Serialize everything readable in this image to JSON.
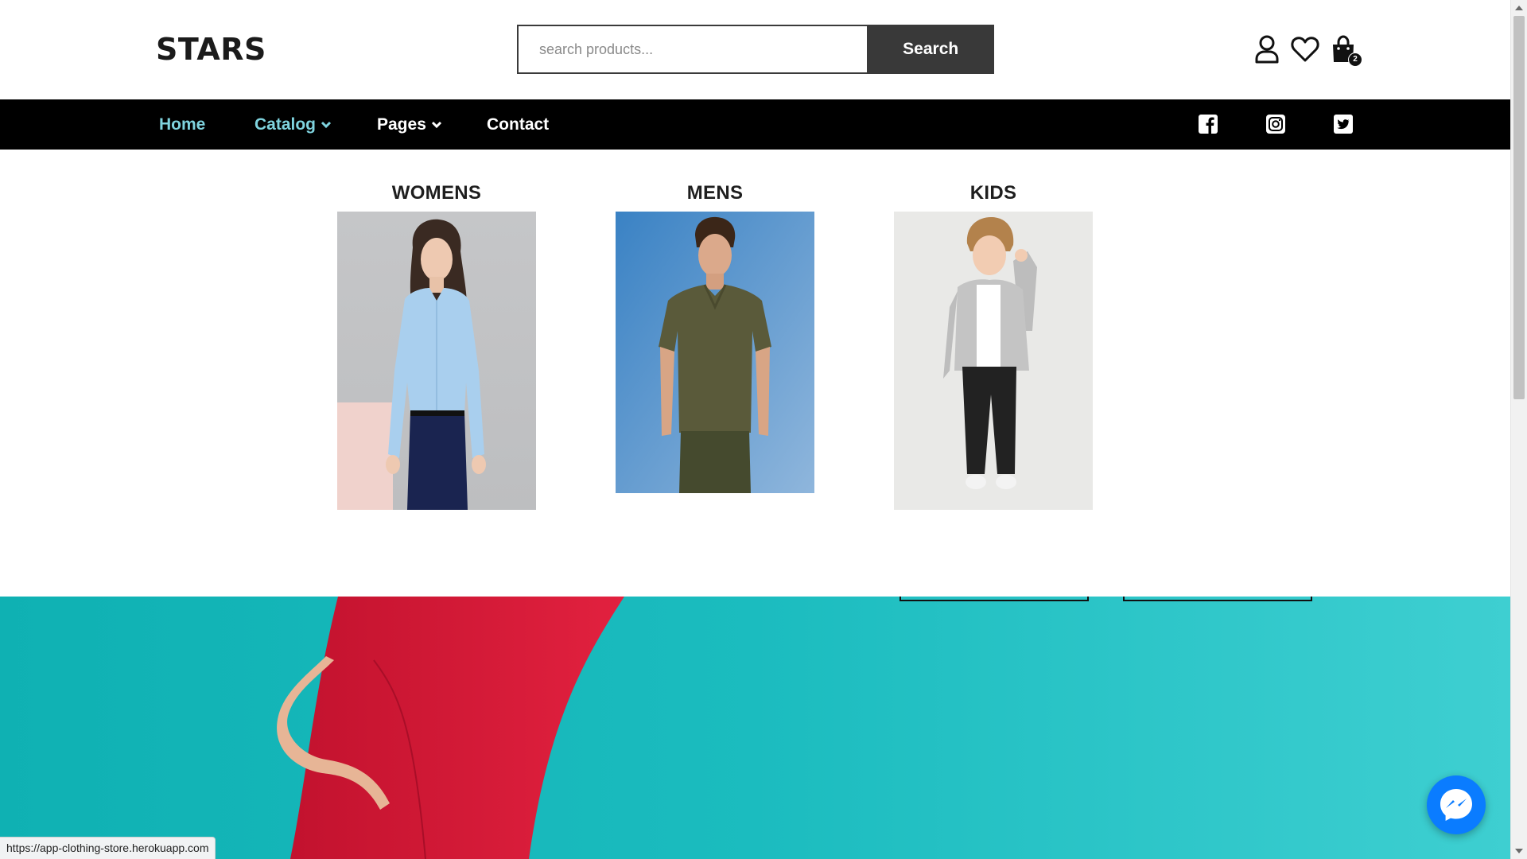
{
  "header": {
    "logo": "STARS",
    "search_placeholder": "search products...",
    "search_button": "Search",
    "cart_count": "2"
  },
  "nav": {
    "items": [
      {
        "label": "Home",
        "active": true
      },
      {
        "label": "Catalog",
        "active": true,
        "has_dropdown": true
      },
      {
        "label": "Pages",
        "active": false,
        "has_dropdown": true
      },
      {
        "label": "Contact",
        "active": false
      }
    ],
    "social": [
      "facebook-icon",
      "instagram-icon",
      "twitter-icon"
    ]
  },
  "mega_menu": {
    "categories": [
      {
        "title": "WOMENS",
        "image": "woman in light blue shirt and navy trousers"
      },
      {
        "title": "MENS",
        "image": "man in olive polo shirt on blue background"
      },
      {
        "title": "KIDS",
        "image": "boy in grey hoodie and black joggers"
      }
    ]
  },
  "status_bar": {
    "url": "https://app-clothing-store.herokuapp.com"
  },
  "colors": {
    "nav_bg": "#000000",
    "nav_active": "#7fd3de",
    "search_button": "#393939",
    "hero_teal": "#1bbcbf",
    "messenger": "#0a7cff"
  }
}
